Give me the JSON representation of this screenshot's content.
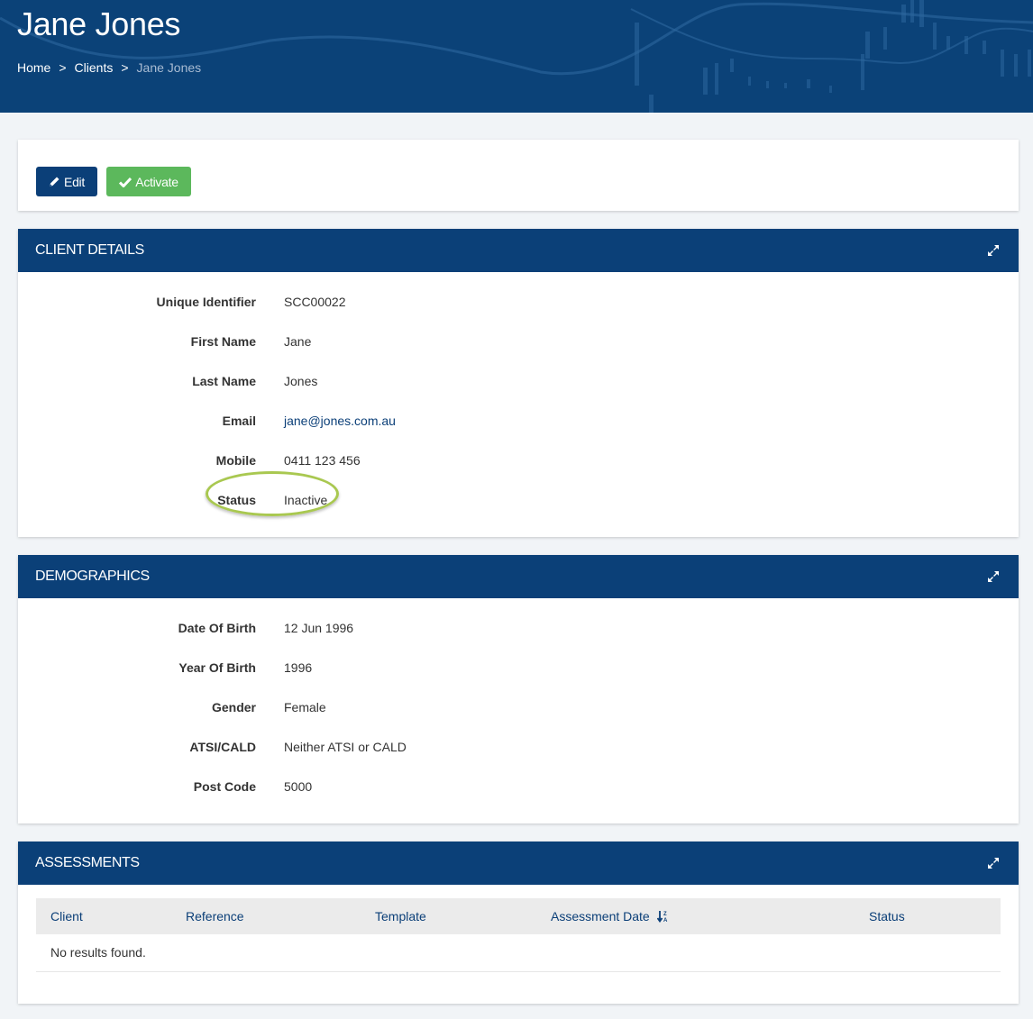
{
  "header": {
    "title": "Jane Jones",
    "breadcrumb": [
      {
        "label": "Home"
      },
      {
        "label": "Clients"
      },
      {
        "label": "Jane Jones"
      }
    ],
    "separator": ">"
  },
  "toolbar": {
    "edit_label": "Edit",
    "activate_label": "Activate"
  },
  "client_details": {
    "title": "CLIENT DETAILS",
    "fields": [
      {
        "label": "Unique Identifier",
        "value": "SCC00022"
      },
      {
        "label": "First Name",
        "value": "Jane"
      },
      {
        "label": "Last Name",
        "value": "Jones"
      },
      {
        "label": "Email",
        "value": "jane@jones.com.au"
      },
      {
        "label": "Mobile",
        "value": "0411 123 456"
      },
      {
        "label": "Status",
        "value": "Inactive"
      }
    ]
  },
  "demographics": {
    "title": "DEMOGRAPHICS",
    "fields": [
      {
        "label": "Date Of Birth",
        "value": "12 Jun 1996"
      },
      {
        "label": "Year Of Birth",
        "value": "1996"
      },
      {
        "label": "Gender",
        "value": "Female"
      },
      {
        "label": "ATSI/CALD",
        "value": "Neither ATSI or CALD"
      },
      {
        "label": "Post Code",
        "value": "5000"
      }
    ]
  },
  "assessments": {
    "title": "ASSESSMENTS",
    "columns": [
      "Client",
      "Reference",
      "Template",
      "Assessment Date",
      "Status"
    ],
    "empty_message": "No results found."
  },
  "colors": {
    "primary": "#0b4078",
    "success": "#5cb85c",
    "highlight": "#a9c850",
    "page_bg": "#f1f4f7"
  }
}
